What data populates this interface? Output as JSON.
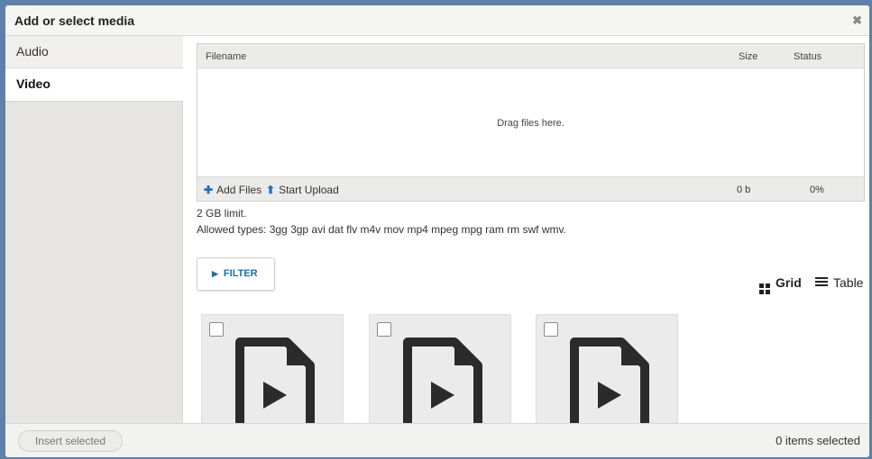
{
  "dialog": {
    "title": "Add or select media",
    "close_glyph": "✖"
  },
  "sidebar": {
    "tabs": [
      {
        "label": "Audio"
      },
      {
        "label": "Video"
      }
    ]
  },
  "uploader": {
    "columns": {
      "filename": "Filename",
      "size": "Size",
      "status": "Status"
    },
    "drop_text": "Drag files here.",
    "add_files": "Add Files",
    "start_upload": "Start Upload",
    "total_size": "0 b",
    "progress": "0%"
  },
  "info": {
    "limit": "2 GB limit.",
    "allowed": "Allowed types: 3gg 3gp avi dat flv m4v mov mp4 mpeg mpg ram rm swf wmv."
  },
  "filter": {
    "label": "FILTER"
  },
  "views": {
    "grid": "Grid",
    "table": "Table"
  },
  "media_items": [
    {
      "icon": "video-file-icon"
    },
    {
      "icon": "video-file-icon"
    },
    {
      "icon": "video-file-icon"
    }
  ],
  "footer": {
    "insert_label": "Insert selected",
    "selected_count": "0 items selected"
  },
  "colors": {
    "accent": "#1f6fb8",
    "frame": "#5f80a8"
  }
}
